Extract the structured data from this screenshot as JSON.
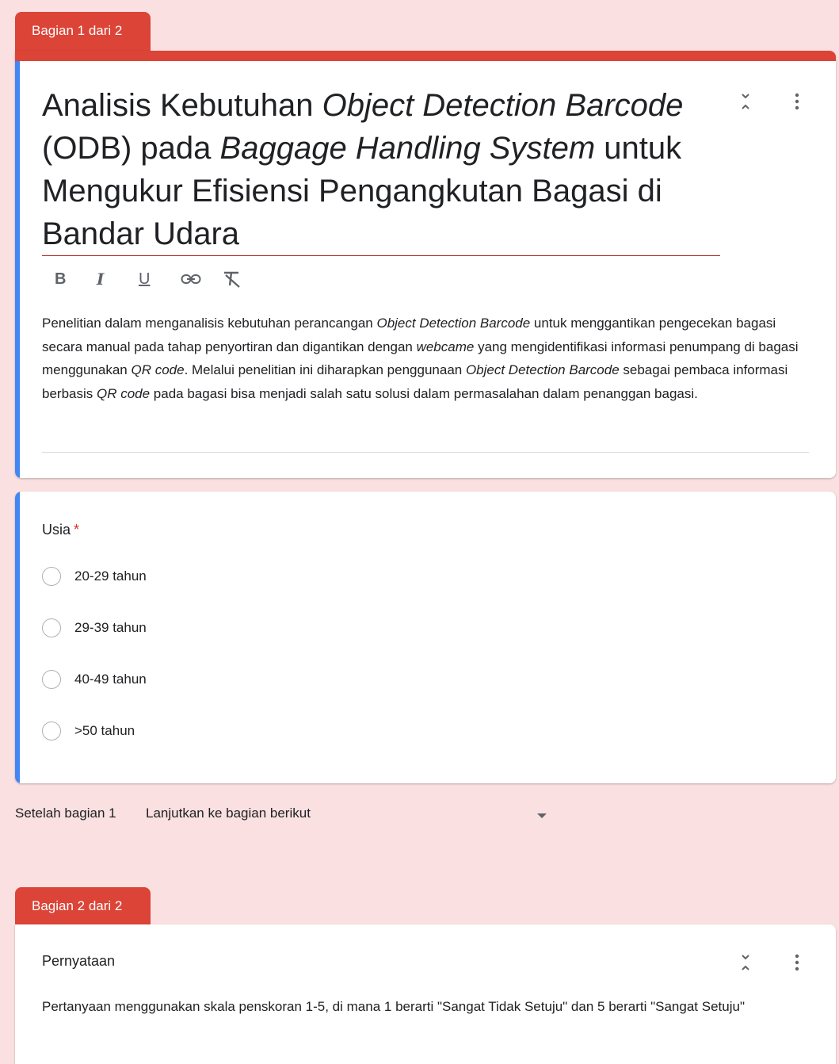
{
  "section1": {
    "tab_label": "Bagian 1 dari 2",
    "title_parts": {
      "p1": "Analisis Kebutuhan ",
      "p2": "Object Detection Barcode",
      "p3": " (ODB) pada ",
      "p4": "Baggage Handling System",
      "p5": " untuk Mengukur Efisiensi Pengangkutan Bagasi di Bandar Udara"
    },
    "toolbar": {
      "bold": "B",
      "italic": "I",
      "underline": "U"
    },
    "description_parts": {
      "d1": "Penelitian dalam menganalisis kebutuhan perancangan ",
      "d2": "Object Detection Barcode",
      "d3": " untuk menggantikan pengecekan bagasi secara manual pada tahap penyortiran dan digantikan dengan ",
      "d4": "webcame",
      "d5": " yang mengidentifikasi informasi penumpang di bagasi menggunakan ",
      "d6": "QR code",
      "d7": ". Melalui penelitian ini diharapkan penggunaan ",
      "d8": "Object Detection Barcode",
      "d9": " sebagai pembaca informasi berbasis ",
      "d10": "QR code",
      "d11": " pada bagasi bisa menjadi salah satu solusi dalam permasalahan dalam penanggan bagasi."
    }
  },
  "question": {
    "title": "Usia",
    "required_mark": "*",
    "options": [
      "20-29 tahun",
      "29-39 tahun",
      "40-49 tahun",
      ">50 tahun"
    ]
  },
  "section_nav": {
    "label": "Setelah bagian 1",
    "selected": "Lanjutkan ke bagian berikut"
  },
  "section2": {
    "tab_label": "Bagian 2 dari 2",
    "title": "Pernyataan",
    "description": "Pertanyaan menggunakan skala penskoran 1-5, di mana 1 berarti \"Sangat Tidak Setuju\" dan 5 berarti \"Sangat Setuju\""
  },
  "colors": {
    "theme_red": "#db4437",
    "accent_blue": "#4285f4",
    "background": "#fae0e0"
  }
}
